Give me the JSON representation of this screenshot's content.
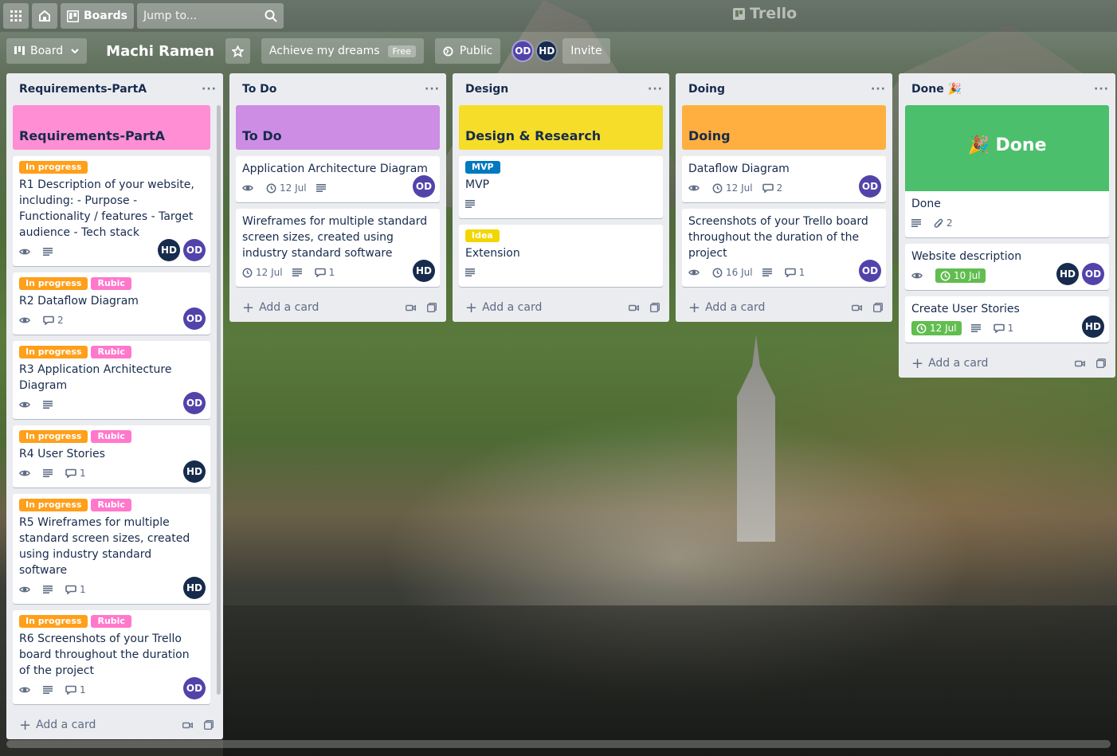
{
  "topnav": {
    "boards_label": "Boards",
    "search_placeholder": "Jump to...",
    "logo_text": "Trello"
  },
  "board": {
    "view_label": "Board",
    "title": "Machi Ramen",
    "workspace_label": "Achieve my dreams",
    "workspace_plan": "Free",
    "visibility_label": "Public",
    "members": [
      "OD",
      "HD"
    ],
    "invite_label": "Invite"
  },
  "colors": {
    "label_in_progress": "#ff9f1a",
    "label_rubic": "#ff78cb",
    "label_mvp": "#0079bf",
    "label_idea": "#f2d600",
    "due_green": "#61bd4f",
    "avatar_od": "#5243aa",
    "avatar_hd": "#172b4d"
  },
  "lists": [
    {
      "title": "Requirements-PartA",
      "cover_title": "Requirements-PartA",
      "cover_color": "#ff8ed4",
      "add_card_label": "Add a card",
      "cards": [
        {
          "labels": [
            "In progress"
          ],
          "title": "R1 Description of your website, including: - Purpose - Functionality / features - Target audience - Tech stack",
          "badges": {
            "watch": true,
            "description": true
          },
          "members": [
            "HD",
            "OD"
          ]
        },
        {
          "labels": [
            "In progress",
            "Rubic"
          ],
          "title": "R2 Dataflow Diagram",
          "badges": {
            "watch": true,
            "comments": "2"
          },
          "members": [
            "OD"
          ]
        },
        {
          "labels": [
            "In progress",
            "Rubic"
          ],
          "title": "R3 Application Architecture Diagram",
          "badges": {
            "watch": true,
            "description": true
          },
          "members": [
            "OD"
          ]
        },
        {
          "labels": [
            "In progress",
            "Rubic"
          ],
          "title": "R4 User Stories",
          "badges": {
            "watch": true,
            "description": true,
            "comments": "1"
          },
          "members": [
            "HD"
          ]
        },
        {
          "labels": [
            "In progress",
            "Rubic"
          ],
          "title": "R5 Wireframes for multiple standard screen sizes, created using industry standard software",
          "badges": {
            "watch": true,
            "description": true,
            "comments": "1"
          },
          "members": [
            "HD"
          ]
        },
        {
          "labels": [
            "In progress",
            "Rubic"
          ],
          "title": "R6 Screenshots of your Trello board throughout the duration of the project",
          "badges": {
            "watch": true,
            "description": true,
            "comments": "1"
          },
          "members": [
            "OD"
          ]
        }
      ]
    },
    {
      "title": "To Do",
      "cover_title": "To Do",
      "cover_color": "#cd8de5",
      "add_card_label": "Add a card",
      "cards": [
        {
          "title": "Application Architecture Diagram",
          "badges": {
            "watch": true,
            "date": "12 Jul",
            "description": true
          },
          "members": [
            "OD"
          ]
        },
        {
          "title": "Wireframes for multiple standard screen sizes, created using industry standard software",
          "badges": {
            "date": "12 Jul",
            "description": true,
            "comments": "1"
          },
          "members": [
            "HD"
          ]
        }
      ]
    },
    {
      "title": "Design",
      "cover_title": "Design & Research",
      "cover_color": "#f5dd29",
      "add_card_label": "Add a card",
      "cards": [
        {
          "labels": [
            "MVP"
          ],
          "title": "MVP",
          "badges": {
            "description": true
          }
        },
        {
          "labels": [
            "Idea"
          ],
          "title": "Extension",
          "badges": {
            "description": true
          }
        }
      ]
    },
    {
      "title": "Doing",
      "cover_title": "Doing",
      "cover_color": "#ffaf3f",
      "add_card_label": "Add a card",
      "cards": [
        {
          "title": "Dataflow Diagram",
          "badges": {
            "watch": true,
            "date": "12 Jul",
            "comments": "2"
          },
          "members": [
            "OD"
          ]
        },
        {
          "title": "Screenshots of your Trello board throughout the duration of the project",
          "badges": {
            "watch": true,
            "date": "16 Jul",
            "description": true,
            "comments": "1"
          },
          "members": [
            "OD"
          ]
        }
      ]
    },
    {
      "title": "Done 🎉",
      "cover_title": "🎉 Done",
      "cover_color": "#4bbf6b",
      "cover_card_title": "Done",
      "cover_card_badges": {
        "description": true,
        "attachments": "2"
      },
      "add_card_label": "Add a card",
      "cards": [
        {
          "title": "Website description",
          "badges": {
            "watch": true,
            "due": "10 Jul"
          },
          "members": [
            "HD",
            "OD"
          ]
        },
        {
          "title": "Create User Stories",
          "badges": {
            "due": "12 Jul",
            "description": true,
            "comments": "1"
          },
          "members": [
            "HD"
          ]
        }
      ]
    }
  ]
}
